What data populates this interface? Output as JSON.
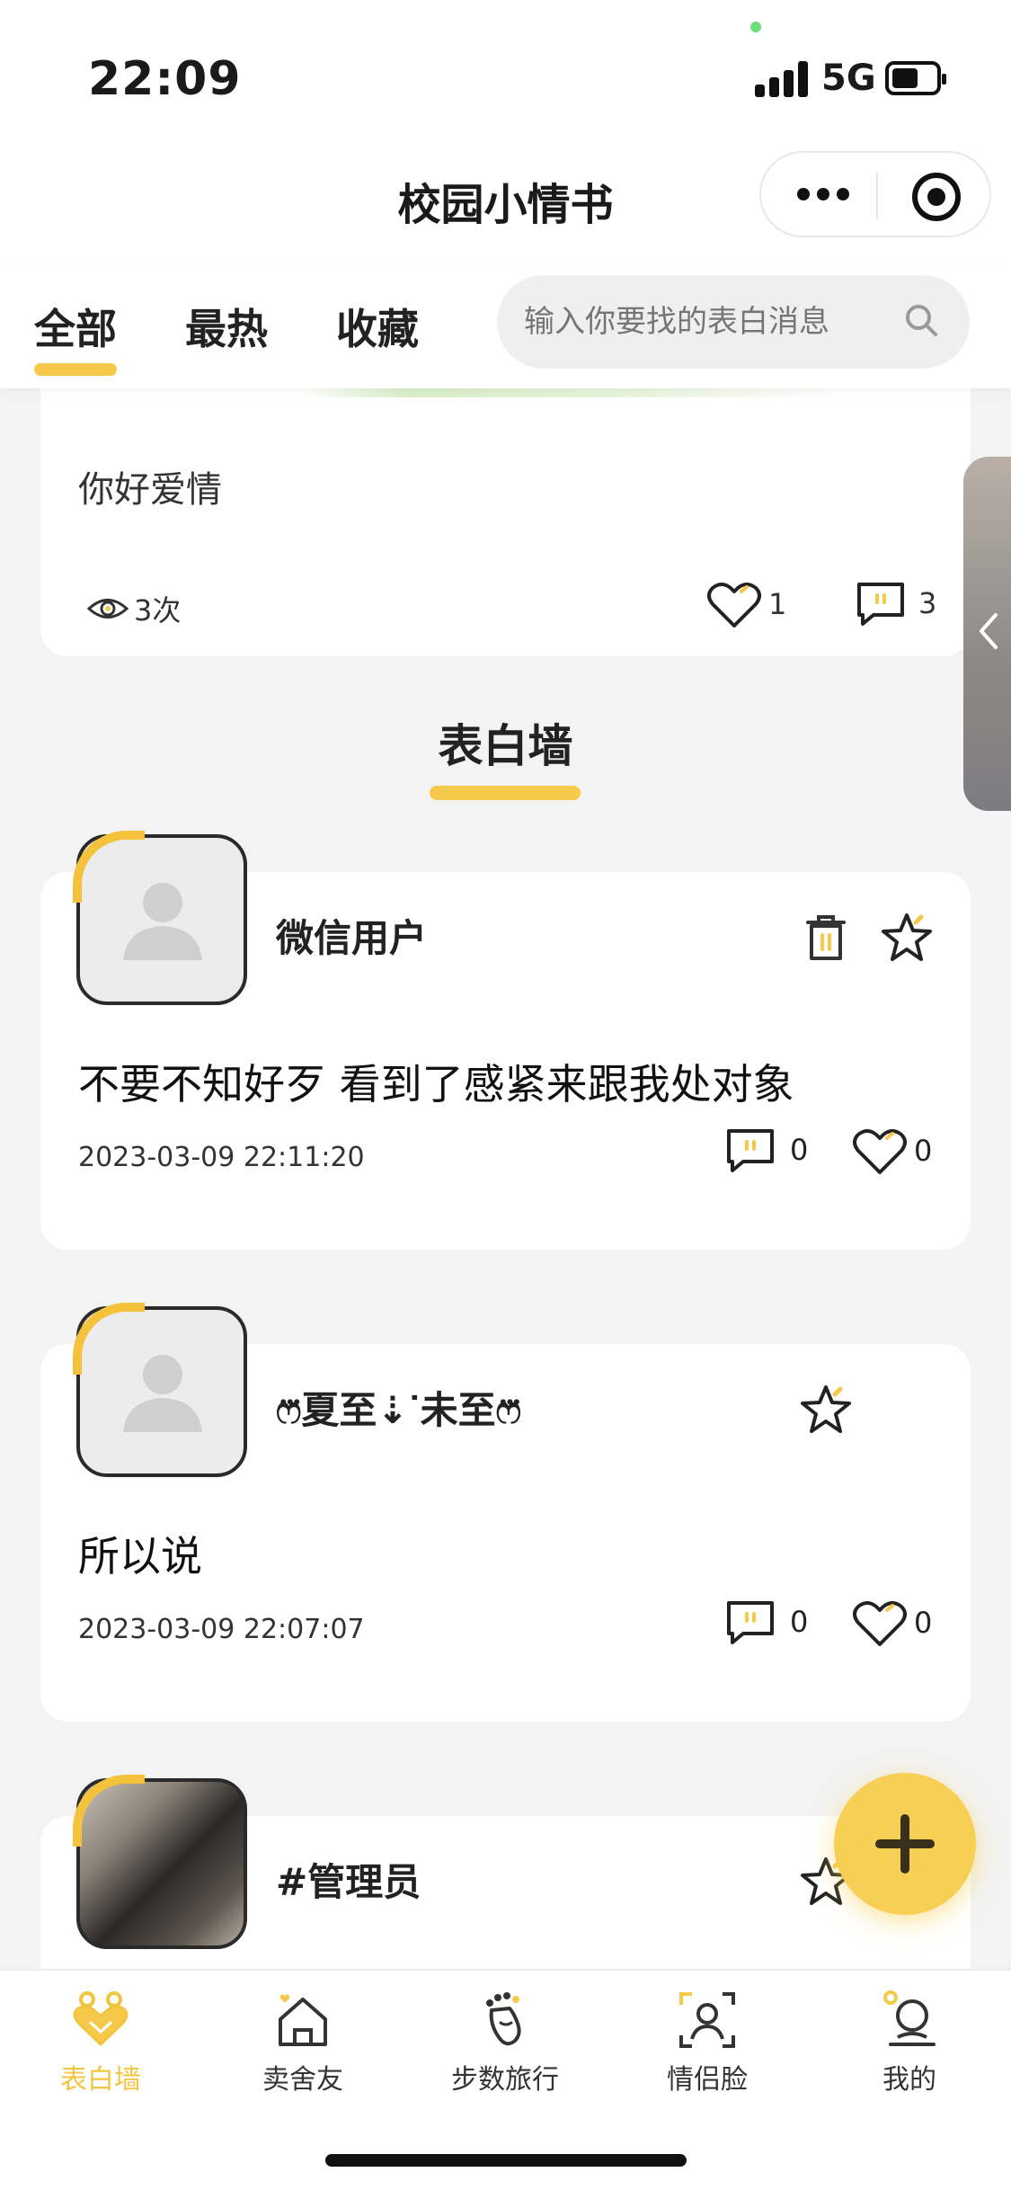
{
  "status_bar": {
    "time": "22:09",
    "network": "5G"
  },
  "app": {
    "title": "校园小情书"
  },
  "tabs": [
    {
      "label": "全部",
      "active": true
    },
    {
      "label": "最热",
      "active": false
    },
    {
      "label": "收藏",
      "active": false
    }
  ],
  "search": {
    "placeholder": "输入你要找的表白消息"
  },
  "top_card": {
    "text": "你好爱情",
    "views": "3次",
    "likes": "1",
    "comments": "3"
  },
  "section": {
    "title": "表白墙"
  },
  "posts": [
    {
      "name": "微信用户",
      "content": "不要不知好歹 看到了感紧来跟我处对象",
      "date": "2023-03-09 22:11:20",
      "comments": "0",
      "likes": "0",
      "deletable": true
    },
    {
      "name": "ෆ⃛夏至⇣ᐝ未至ෆ⃛",
      "content": "所以说",
      "date": "2023-03-09 22:07:07",
      "comments": "0",
      "likes": "0",
      "deletable": false
    },
    {
      "name": "#管理员",
      "content": "",
      "date": "",
      "comments": "",
      "likes": "",
      "deletable": false
    }
  ],
  "bottom_nav": [
    {
      "label": "表白墙",
      "icon": "heart-hands-icon",
      "active": true
    },
    {
      "label": "卖舍友",
      "icon": "house-heart-icon",
      "active": false
    },
    {
      "label": "步数旅行",
      "icon": "footprint-icon",
      "active": false
    },
    {
      "label": "情侣脸",
      "icon": "face-scan-icon",
      "active": false
    },
    {
      "label": "我的",
      "icon": "profile-icon",
      "active": false
    }
  ],
  "colors": {
    "accent": "#f7c94a",
    "background": "#f3f3f3",
    "card": "#ffffff"
  }
}
